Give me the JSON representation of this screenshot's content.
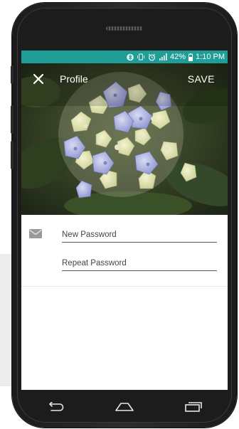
{
  "status_bar": {
    "icons": [
      "bluetooth-icon",
      "vibrate-icon",
      "alarm-icon",
      "signal-icon",
      "battery-icon"
    ],
    "battery": "42%",
    "time": "1:10 PM",
    "color": "#1f9d97"
  },
  "toolbar": {
    "close_icon": "close-icon",
    "title": "Profile",
    "save_label": "SAVE"
  },
  "form": {
    "icon": "mail-icon",
    "new_password_placeholder": "New Password",
    "repeat_password_placeholder": "Repeat Password"
  },
  "nav_bar": {
    "back_icon": "back-icon",
    "home_icon": "home-icon",
    "recents_icon": "recents-icon"
  }
}
